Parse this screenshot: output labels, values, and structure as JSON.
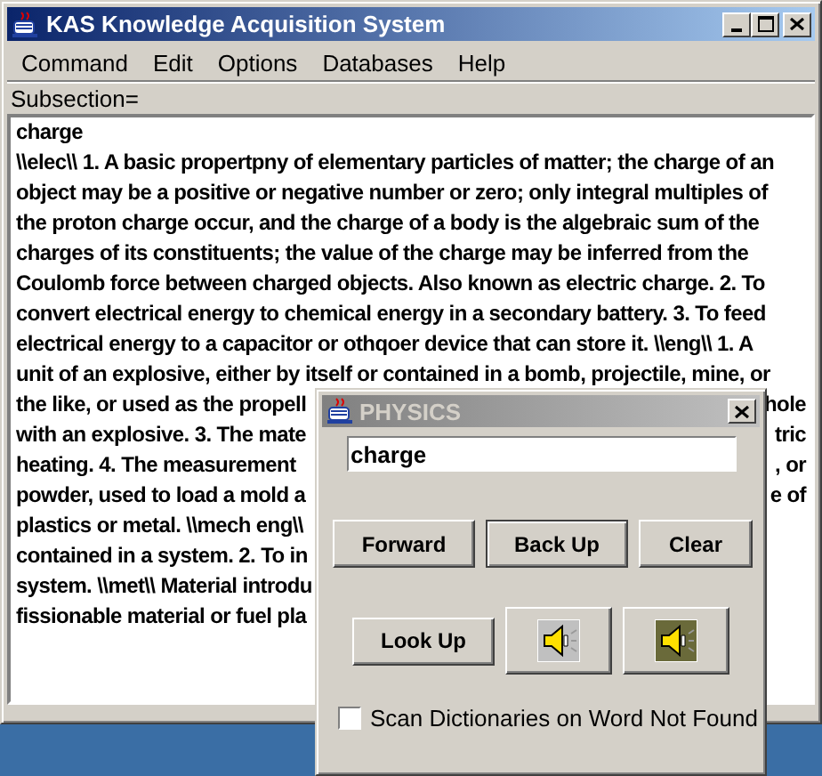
{
  "window": {
    "title": "KAS Knowledge Acquisition System"
  },
  "menu": [
    "Command",
    "Edit",
    "Options",
    "Databases",
    "Help"
  ],
  "subsection_label": "Subsection=",
  "entry": {
    "headword": "charge",
    "lines": [
      {
        "left": "\\\\elec\\\\ 1. A basic propertpny of elementary particles of matter; the charge of an"
      },
      {
        "left": "object may be a positive or negative number or zero; only integral multiples of"
      },
      {
        "left": "the proton charge occur, and the charge of a body is the algebraic sum of the"
      },
      {
        "left": "charges of its constituents; the value of the charge may be inferred from the"
      },
      {
        "left": "Coulomb force between charged objects. Also known as electric charge. 2. To"
      },
      {
        "left": "convert electrical energy to chemical energy in a secondary battery. 3. To feed"
      },
      {
        "left": "electrical energy to a capacitor or othqoer device that can store it. \\\\eng\\\\ 1. A"
      },
      {
        "left": "unit of an explosive, either by itself or contained in a bomb, projectile, mine, or"
      },
      {
        "left": "the like, or used as the propell",
        "right": "hole"
      },
      {
        "left": "with an explosive. 3. The mate",
        "right": "tric"
      },
      {
        "left": "heating. 4. The measurement",
        "right": ", or"
      },
      {
        "left": "powder, used to load a mold a",
        "right": "e of"
      },
      {
        "left": "plastics or metal. \\\\mech eng\\\\"
      },
      {
        "left": "contained in a system. 2. To in"
      },
      {
        "left": "system. \\\\met\\\\ Material introdu"
      },
      {
        "left": "fissionable material or fuel pla"
      }
    ]
  },
  "dialog": {
    "title": "PHYSICS",
    "field_value": "charge",
    "buttons": [
      {
        "label": "Forward",
        "focused": false
      },
      {
        "label": "Back Up",
        "focused": true
      },
      {
        "label": "Clear",
        "focused": false
      },
      {
        "label": "Look Up",
        "focused": false
      }
    ],
    "checkbox": {
      "label": "Scan Dictionaries on Word Not Found",
      "checked": false
    }
  }
}
